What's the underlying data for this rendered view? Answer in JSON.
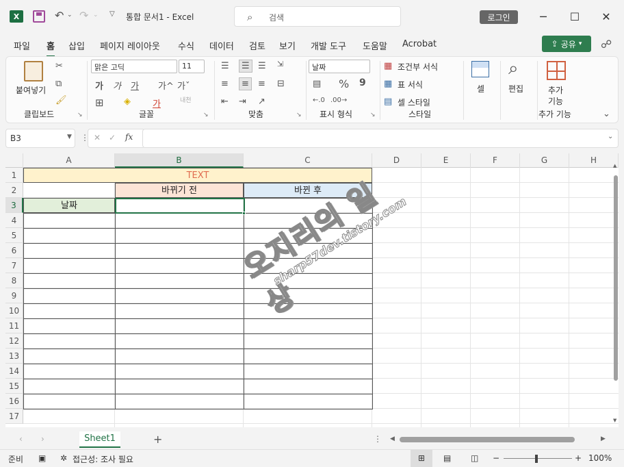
{
  "app": {
    "logo": "X",
    "title": "통합 문서1  -  Excel"
  },
  "search": {
    "placeholder": "검색"
  },
  "account": {
    "login_label": "로그인"
  },
  "window_controls": {
    "minimize": "─",
    "maximize": "☐",
    "close": "✕"
  },
  "menu": {
    "tabs": [
      "파일",
      "홈",
      "삽입",
      "페이지 레이아웃",
      "수식",
      "데이터",
      "검토",
      "보기",
      "개발 도구",
      "도움말",
      "Acrobat"
    ],
    "active": "홈",
    "share_label": "공유"
  },
  "ribbon": {
    "clipboard": {
      "paste_label": "붙여넣기",
      "group_label": "클립보드"
    },
    "font": {
      "font_name": "맑은 고딕",
      "font_size": "11",
      "group_label": "글꼴",
      "bold": "가",
      "italic": "가",
      "underline": "가",
      "grow": "가^",
      "shrink": "가ˇ",
      "color_glyph": "가",
      "phonetic": "내천"
    },
    "alignment": {
      "group_label": "맞춤"
    },
    "number": {
      "format": "날짜",
      "percent": "%",
      "comma": "9",
      "group_label": "표시 형식"
    },
    "styles": {
      "conditional": "조건부 서식",
      "table": "표 서식",
      "cell_style": "셀 스타일",
      "group_label": "스타일"
    },
    "cells": {
      "label": "셀"
    },
    "editing": {
      "label": "편집"
    },
    "addins": {
      "label1": "추가",
      "label2": "기능",
      "group_label": "추가 기능"
    }
  },
  "formula_bar": {
    "name_box": "B3",
    "fx": "fx",
    "value": ""
  },
  "grid": {
    "columns": [
      "A",
      "B",
      "C",
      "D",
      "E",
      "F",
      "G",
      "H"
    ],
    "rows": [
      "1",
      "2",
      "3",
      "4",
      "5",
      "6",
      "7",
      "8",
      "9",
      "10",
      "11",
      "12",
      "13",
      "14",
      "15",
      "16",
      "17"
    ],
    "selected_col": "B",
    "selected_row": "3",
    "cells": {
      "A1": "TEXT",
      "B2": "바뀌기 전",
      "C2": "바뀐 후",
      "A3": "날짜"
    },
    "colors": {
      "header_fill": "#fff2cc",
      "before_fill": "#fce4d6",
      "after_fill": "#ddebf7",
      "date_fill": "#e2efda",
      "text_color": "#e06c4f"
    }
  },
  "watermark": {
    "main": "오지리의 일상",
    "sub": "sharp57dev.tistory.com"
  },
  "sheets": {
    "tabs": [
      "Sheet1"
    ],
    "add": "+"
  },
  "status": {
    "ready": "준비",
    "accessibility": "접근성: 조사 필요",
    "zoom": "100%"
  }
}
